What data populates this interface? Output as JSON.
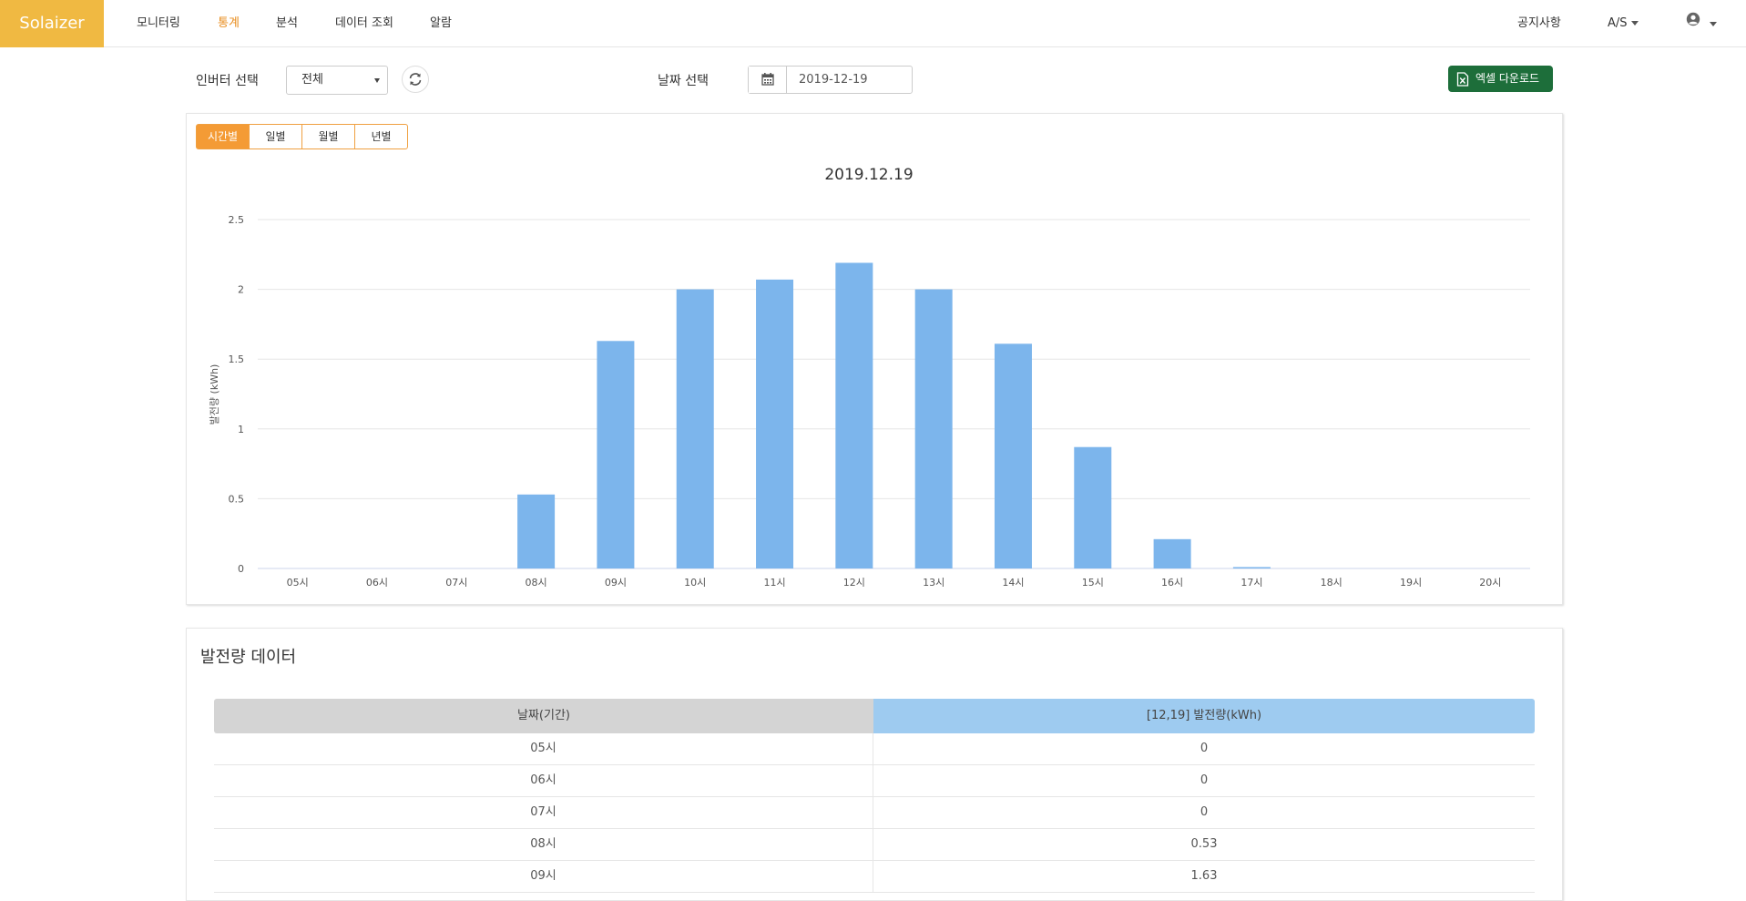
{
  "app": {
    "brand": "Solaizer"
  },
  "nav": {
    "items": [
      {
        "label": "모니터링",
        "active": false
      },
      {
        "label": "통계",
        "active": true
      },
      {
        "label": "분석",
        "active": false
      },
      {
        "label": "데이터 조회",
        "active": false
      },
      {
        "label": "알람",
        "active": false
      }
    ],
    "notice_label": "공지사항",
    "as_label": "A/S"
  },
  "controls": {
    "inverter_label": "인버터 선택",
    "inverter_value": "전체",
    "date_label": "날짜 선택",
    "date_value": "2019-12-19",
    "excel_label": "엑셀 다운로드"
  },
  "tabs": [
    {
      "label": "시간별",
      "active": true
    },
    {
      "label": "일별",
      "active": false
    },
    {
      "label": "월별",
      "active": false
    },
    {
      "label": "년별",
      "active": false
    }
  ],
  "chart_data": {
    "type": "bar",
    "title": "2019.12.19",
    "ylabel": "발전량 (kWh)",
    "xlabel": "",
    "categories": [
      "05시",
      "06시",
      "07시",
      "08시",
      "09시",
      "10시",
      "11시",
      "12시",
      "13시",
      "14시",
      "15시",
      "16시",
      "17시",
      "18시",
      "19시",
      "20시"
    ],
    "values": [
      0,
      0,
      0,
      0.53,
      1.63,
      2.0,
      2.07,
      2.19,
      2.0,
      1.61,
      0.87,
      0.21,
      0.01,
      0,
      0,
      0
    ],
    "ylim": [
      0,
      2.5
    ],
    "yticks": [
      "0",
      "0.5",
      "1",
      "1.5",
      "2",
      "2.5"
    ],
    "grid": true,
    "colors": {
      "bar": "#7cb5ec",
      "grid": "#e6e6e6"
    }
  },
  "table": {
    "title": "발전량 데이터",
    "headers": [
      "날짜(기간)",
      "[12,19] 발전량(kWh)"
    ],
    "rows": [
      [
        "05시",
        "0"
      ],
      [
        "06시",
        "0"
      ],
      [
        "07시",
        "0"
      ],
      [
        "08시",
        "0.53"
      ],
      [
        "09시",
        "1.63"
      ]
    ]
  }
}
